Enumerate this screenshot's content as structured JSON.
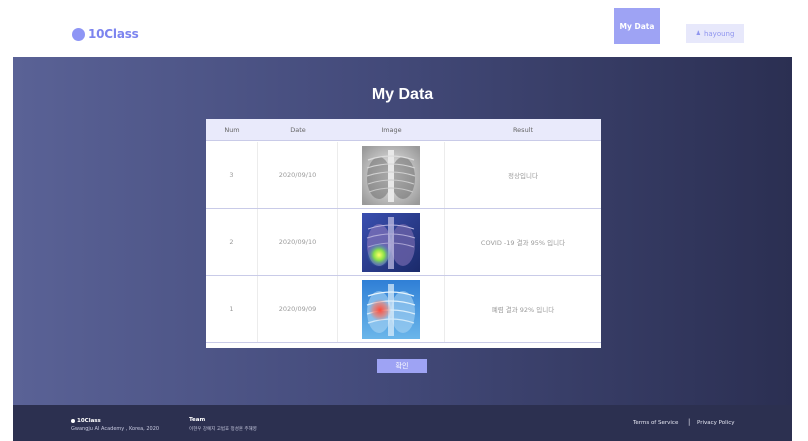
{
  "header": {
    "logo_text": "10Class",
    "nav_mydata_label": "My Data",
    "user_label": "hayoung",
    "user_icon": "person-icon"
  },
  "main": {
    "title": "My Data",
    "columns": [
      "Num",
      "Date",
      "Image",
      "Result"
    ],
    "rows": [
      {
        "num": "3",
        "date": "2020/09/10",
        "image": "chest-xray-normal",
        "result": "정상입니다"
      },
      {
        "num": "2",
        "date": "2020/09/10",
        "image": "chest-xray-covid-heatmap",
        "result": "COVID -19 결과 95% 입니다"
      },
      {
        "num": "1",
        "date": "2020/09/09",
        "image": "chest-xray-pneumonia-heatmap",
        "result": "폐렴 결과 92% 입니다"
      }
    ],
    "confirm_label": "확인"
  },
  "footer": {
    "brand": "10Class",
    "academy": "Gwangju AI Academy , Korea, 2020",
    "team_label": "Team",
    "members": "이현우 강예지 고범효 정성훈 주해영",
    "terms": "Terms of Service",
    "separator": "|",
    "privacy": "Privacy Policy"
  },
  "colors": {
    "accent": "#9ea3f4",
    "logo": "#7c84ef",
    "band_left": "#5a6296",
    "band_right": "#2b2f52",
    "footer": "#2c3050"
  }
}
